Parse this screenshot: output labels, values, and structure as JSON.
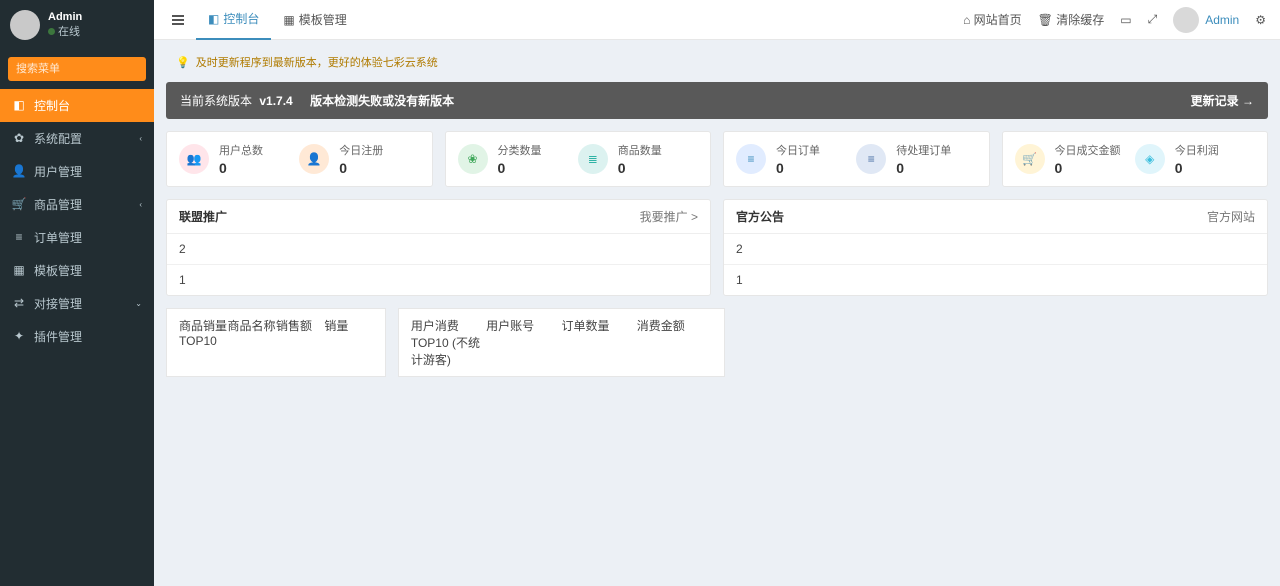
{
  "sidebar": {
    "user_name": "Admin",
    "user_status": "在线",
    "search_placeholder": "搜索菜单",
    "items": [
      {
        "icon": "dashboard-icon",
        "label": "控制台",
        "caret": ""
      },
      {
        "icon": "gear-icon",
        "label": "系统配置",
        "caret": "‹"
      },
      {
        "icon": "user-icon",
        "label": "用户管理",
        "caret": ""
      },
      {
        "icon": "cart-icon",
        "label": "商品管理",
        "caret": "‹"
      },
      {
        "icon": "list-icon",
        "label": "订单管理",
        "caret": ""
      },
      {
        "icon": "template-icon",
        "label": "模板管理",
        "caret": ""
      },
      {
        "icon": "connect-icon",
        "label": "对接管理",
        "caret": "⌄"
      },
      {
        "icon": "plugin-icon",
        "label": "插件管理",
        "caret": ""
      }
    ]
  },
  "topbar": {
    "tabs": [
      {
        "icon": "dashboard-icon",
        "label": "控制台"
      },
      {
        "icon": "template-icon",
        "label": "模板管理"
      }
    ],
    "links": {
      "site_home": "网站首页",
      "clear_cache": "清除缓存"
    },
    "user": "Admin"
  },
  "alert": "及时更新程序到最新版本，更好的体验七彩云系统",
  "version": {
    "prefix": "当前系统版本",
    "ver": "v1.7.4",
    "status": "版本检测失败或没有新版本",
    "history": "更新记录 →"
  },
  "stats": [
    [
      {
        "color": "ic-rose",
        "label": "用户总数",
        "value": "0"
      },
      {
        "color": "ic-orange",
        "label": "今日注册",
        "value": "0"
      }
    ],
    [
      {
        "color": "ic-green",
        "label": "分类数量",
        "value": "0"
      },
      {
        "color": "ic-teal",
        "label": "商品数量",
        "value": "0"
      }
    ],
    [
      {
        "color": "ic-blue",
        "label": "今日订单",
        "value": "0"
      },
      {
        "color": "ic-navy",
        "label": "待处理订单",
        "value": "0"
      }
    ],
    [
      {
        "color": "ic-yellow",
        "label": "今日成交金额",
        "value": "0"
      },
      {
        "color": "ic-cyan",
        "label": "今日利润",
        "value": "0"
      }
    ]
  ],
  "panels": {
    "promo": {
      "title": "联盟推广",
      "action": "我要推广 >",
      "rows": [
        "2",
        "1"
      ]
    },
    "notice": {
      "title": "官方公告",
      "action": "官方网站",
      "rows": [
        "2",
        "1"
      ]
    }
  },
  "tables": {
    "sales": {
      "c1": "商品销量TOP10",
      "c2": "商品名称",
      "c3": "销售额",
      "c4": "销量"
    },
    "consume": {
      "c1": "用户消费TOP10 (不统计游客)",
      "c2": "用户账号",
      "c3": "订单数量",
      "c4": "消费金额"
    }
  }
}
